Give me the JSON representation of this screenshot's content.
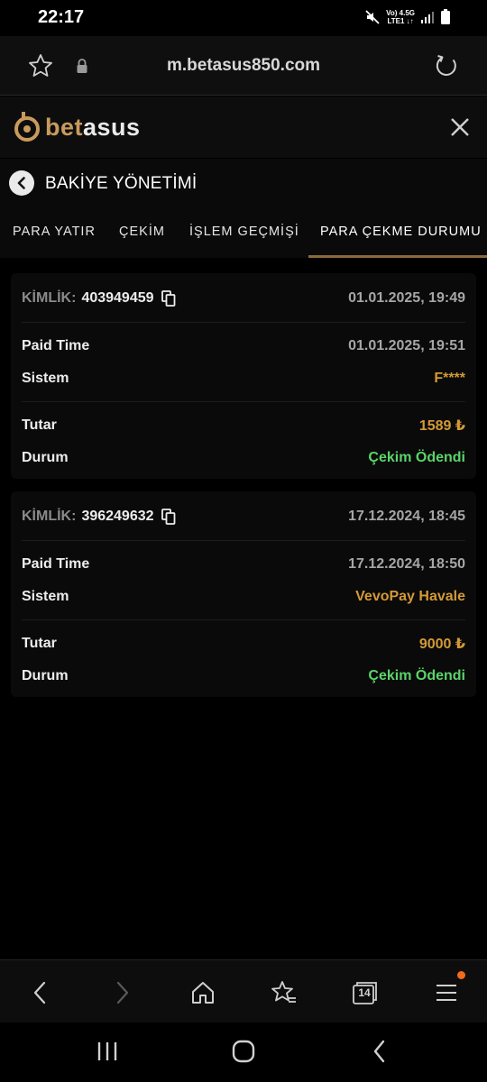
{
  "status_bar": {
    "time": "22:17",
    "network_top": "Vo) 4.5G",
    "network_bottom": "LTE1 ↓↑",
    "icons": [
      "mute-icon",
      "signal-icon",
      "battery-icon"
    ]
  },
  "browser": {
    "url": "m.betasus850.com",
    "icons": [
      "star-icon",
      "lock-icon",
      "reload-icon"
    ]
  },
  "site": {
    "logo_prefix": "bet",
    "logo_suffix": "asus",
    "accent_color": "#c89b5c"
  },
  "page": {
    "title": "BAKİYE YÖNETİMİ"
  },
  "tabs": [
    {
      "label": "PARA YATIR",
      "active": false
    },
    {
      "label": "ÇEKİM",
      "active": false
    },
    {
      "label": "İŞLEM GEÇMİŞİ",
      "active": false
    },
    {
      "label": "PARA ÇEKME DURUMU",
      "active": true
    }
  ],
  "withdrawals": [
    {
      "id_label": "KİMLİK:",
      "id": "403949459",
      "created": "01.01.2025, 19:49",
      "paid_time_label": "Paid Time",
      "paid_time": "01.01.2025, 19:51",
      "system_label": "Sistem",
      "system": "F****",
      "amount_label": "Tutar",
      "amount": "1589 ₺",
      "status_label": "Durum",
      "status": "Çekim Ödendi"
    },
    {
      "id_label": "KİMLİK:",
      "id": "396249632",
      "created": "17.12.2024, 18:45",
      "paid_time_label": "Paid Time",
      "paid_time": "17.12.2024, 18:50",
      "system_label": "Sistem",
      "system": "VevoPay Havale",
      "amount_label": "Tutar",
      "amount": "9000 ₺",
      "status_label": "Durum",
      "status": "Çekim Ödendi"
    }
  ],
  "bottom_nav": {
    "tab_count": "14",
    "icons": [
      "back-arrow-icon",
      "forward-arrow-icon",
      "home-icon",
      "bookmarks-icon",
      "tabs-icon",
      "menu-icon"
    ]
  },
  "colors": {
    "gold": "#d39a36",
    "green": "#5ad46a",
    "notification": "#f06b1d"
  }
}
